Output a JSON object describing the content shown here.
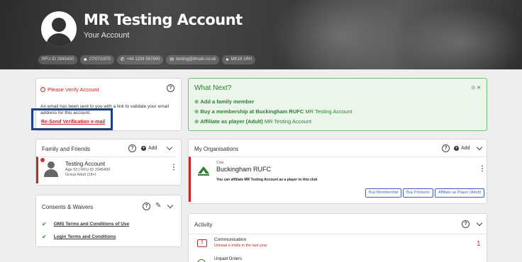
{
  "header": {
    "title": "MR Testing Account",
    "subtitle": "Your Account",
    "chips": [
      {
        "icon": "id-text",
        "text": "RFU ID 2945400"
      },
      {
        "icon": "cake-icon",
        "text": "27/07/1970"
      },
      {
        "icon": "phone-icon",
        "text": "+44 1234 567890"
      },
      {
        "icon": "email-icon",
        "text": "testing@dmain.co.uk"
      },
      {
        "icon": "location-icon",
        "text": "MK18 1RH"
      }
    ]
  },
  "verify": {
    "title": "Please Verify Account",
    "text": "An email has been sent to you with a link to validate your email address for this account.",
    "resend_label": "Re-Send Verification e-mail"
  },
  "what_next": {
    "title": "What Next?",
    "items": [
      {
        "bold": "Add a family member",
        "rest": ""
      },
      {
        "bold": "Buy a membership at Buckingham RUFC",
        "rest": " MR Testing Account"
      },
      {
        "bold": "Affiliate as player (Adult)",
        "rest": " MR Testing Account"
      }
    ]
  },
  "family": {
    "title": "Family and Friends",
    "add_label": "Add",
    "member": {
      "name": "Testing Account",
      "meta": "Age 53 | RFU ID 2945400",
      "group": "Group Adult (18+)"
    }
  },
  "consents": {
    "title": "Consents & Waivers",
    "items": [
      "GMS Terms and Conditions of Use",
      "Login Terms and Conditions"
    ]
  },
  "orgs": {
    "title": "My Organisations",
    "add_label": "Add",
    "club_type": "Club",
    "club_name": "Buckingham RUFC",
    "club_note": "You can affiliate MR Testing Account as a player to this club",
    "buttons": [
      "Buy Membership",
      "Buy Products",
      "Affiliate as Player (Adult)"
    ]
  },
  "activity": {
    "title": "Activity",
    "items": [
      {
        "title": "Communication",
        "sub": "Unread e-mails in the last year",
        "count": "1"
      },
      {
        "title": "Unpaid Orders",
        "sub": "",
        "count": ""
      }
    ]
  },
  "colors": {
    "accent_red": "#c62828",
    "success_green": "#2e7d32",
    "link_blue": "#3b64b8",
    "highlight_navy": "#1c3f8c"
  }
}
